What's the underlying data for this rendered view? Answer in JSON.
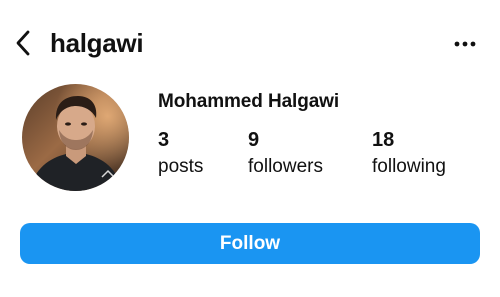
{
  "header": {
    "username": "halgawi",
    "back_icon": "chevron-left-icon",
    "more_icon": "more-horizontal-icon"
  },
  "profile": {
    "display_name": "Mohammed Halgawi",
    "stats": {
      "posts": {
        "value": "3",
        "label": "posts"
      },
      "followers": {
        "value": "9",
        "label": "followers"
      },
      "following": {
        "value": "18",
        "label": "following"
      }
    }
  },
  "actions": {
    "follow_label": "Follow",
    "follow_color": "#1a95f2"
  }
}
